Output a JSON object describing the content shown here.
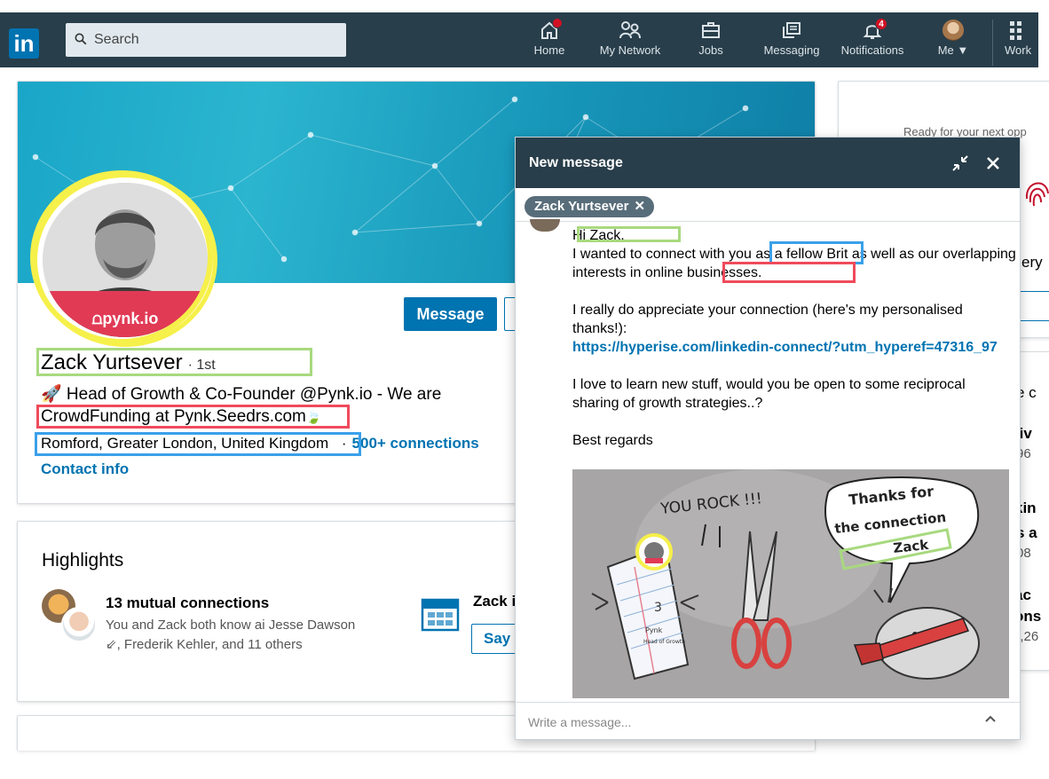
{
  "nav": {
    "logo": "in",
    "search_placeholder": "Search",
    "items": [
      {
        "label": "Home"
      },
      {
        "label": "My Network"
      },
      {
        "label": "Jobs"
      },
      {
        "label": "Messaging"
      },
      {
        "label": "Notifications",
        "badge": "4"
      },
      {
        "label": "Me ▼"
      },
      {
        "label": "Work"
      }
    ]
  },
  "profile": {
    "name": "Zack Yurtsever",
    "degree": "· 1st",
    "headline_1": "🚀 Head of Growth & Co-Founder @Pynk.io - We are",
    "headline_2": "CrowdFunding at Pynk.Seedrs.com",
    "headline_leaf": "🍃",
    "location": "Romford, Greater London, United Kingdom",
    "separator": "·",
    "connections": "500+ connections",
    "contact_info": "Contact info",
    "message_button": "Message",
    "avatar_brand": "⩍pynk.io"
  },
  "highlights": {
    "title": "Highlights",
    "mutual_title": "13 mutual connections",
    "mutual_desc_1": "You and Zack both know ai Jesse Dawson",
    "mutual_desc_2": "⇙, Frederik Kehler, and 11 others",
    "zack_snippet": "Zack i",
    "say_button": "Say"
  },
  "rail": {
    "ad_text": "Ready for your next opp",
    "peek_1": "ery",
    "peek_2": "e c",
    "peek_3": "tiv",
    "peek_4": "96",
    "peek_5": "kin",
    "peek_6": "s a",
    "peek_7": "08",
    "peek_8": "ac",
    "peek_9": "ons",
    "peek_10": "5,26"
  },
  "message": {
    "title": "New message",
    "recipient": "Zack Yurtsever",
    "recipient_remove": "✕",
    "greeting": "Hi Zack,",
    "line_1": "I wanted to connect with you as a fellow Brit as well as our overlapping interests in online businesses.",
    "line_2": "I really do appreciate your connection (here's my personalised thanks!):",
    "link": "https://hyperise.com/linkedin-connect/?utm_hyperef=47316_97",
    "line_3": "I love to learn new stuff, would you be open to some reciprocal sharing of growth strategies..?",
    "signoff": "Best regards",
    "compose_placeholder": "Write a message...",
    "image_text": {
      "you_rock": "YOU ROCK !!!",
      "thanks_1": "Thanks for",
      "thanks_2": "the connection",
      "thanks_name": "Zack",
      "paper_number": "3",
      "paper_brand": "Pynk",
      "paper_role": "Head of Growth"
    }
  },
  "colors": {
    "nav_bg": "#283e4a",
    "brand_blue": "#0073b1",
    "annotation_green": "#a8d97f",
    "annotation_red": "#ef4a5b",
    "annotation_blue": "#3aa0ea",
    "annotation_yellow": "#f6f04a"
  }
}
